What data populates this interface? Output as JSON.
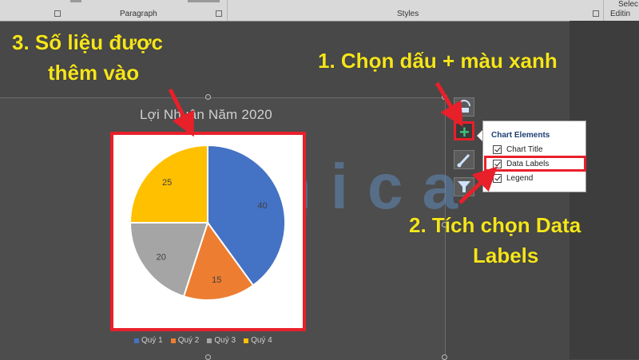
{
  "ribbon": {
    "paragraph_label": "Paragraph",
    "styles_label": "Styles",
    "editing_label": "Editin",
    "select_label": "Selec"
  },
  "chart": {
    "title": "Lợi Nhuận Năm 2020",
    "legend": [
      "Quý 1",
      "Quý 2",
      "Quý 3",
      "Quý 4"
    ],
    "colors": [
      "#4472c4",
      "#ed7d31",
      "#a5a5a5",
      "#ffc000"
    ]
  },
  "chart_data": {
    "type": "pie",
    "title": "Lợi Nhuận Năm 2020",
    "categories": [
      "Quý 1",
      "Quý 2",
      "Quý 3",
      "Quý 4"
    ],
    "values": [
      40,
      15,
      20,
      25
    ],
    "data_labels": true,
    "legend": "bottom"
  },
  "side_buttons": [
    {
      "icon": "layout-options-icon"
    },
    {
      "icon": "plus-icon"
    },
    {
      "icon": "brush-icon"
    },
    {
      "icon": "filter-icon"
    }
  ],
  "popup": {
    "title": "Chart Elements",
    "items": [
      {
        "label": "Chart Title",
        "checked": true
      },
      {
        "label": "Data Labels",
        "checked": true
      },
      {
        "label": "Legend",
        "checked": true
      }
    ]
  },
  "annotations": {
    "step1": "1. Chọn dấu + màu xanh",
    "step2_line1": "2. Tích chọn Data",
    "step2_line2": "Labels",
    "step3_line1": "3. Số liệu được",
    "step3_line2": "thêm vào",
    "color": "#f5e51b",
    "highlight_color": "#e8202a"
  },
  "watermark": "unica"
}
